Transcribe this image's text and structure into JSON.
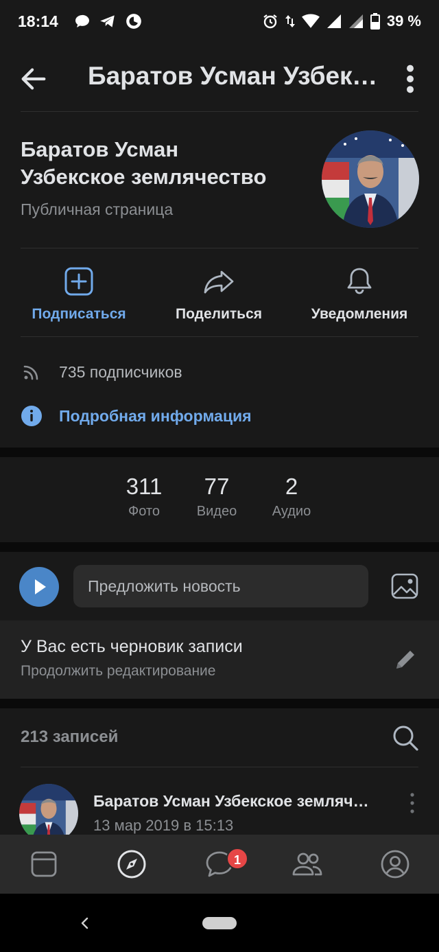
{
  "status_bar": {
    "time": "18:14",
    "battery": "39 %"
  },
  "header": {
    "title": "Баратов Усман Узбекское землячество"
  },
  "profile": {
    "name_line1": "Баратов Усман",
    "name_line2": "Узбекское землячество",
    "type": "Публичная страница"
  },
  "actions": [
    {
      "label": "Подписаться",
      "icon": "plus-square-icon"
    },
    {
      "label": "Поделиться",
      "icon": "share-icon"
    },
    {
      "label": "Уведомления",
      "icon": "bell-icon"
    }
  ],
  "info": {
    "followers": "735 подписчиков",
    "details_link": "Подробная информация"
  },
  "counters": [
    {
      "value": "311",
      "label": "Фото"
    },
    {
      "value": "77",
      "label": "Видео"
    },
    {
      "value": "2",
      "label": "Аудио"
    }
  ],
  "suggest": {
    "placeholder": "Предложить новость"
  },
  "draft": {
    "title": "У Вас есть черновик записи",
    "subtitle": "Продолжить редактирование"
  },
  "posts": {
    "count_label": "213 записей",
    "first_post": {
      "author": "Баратов Усман Узбекское землячество",
      "date": "13 мар 2019 в 15:13"
    }
  },
  "tabbar": {
    "items": [
      "news-tab-icon",
      "explore-tab-icon",
      "messages-tab-icon",
      "friends-tab-icon",
      "profile-tab-icon"
    ],
    "messages_badge": "1"
  },
  "colors": {
    "background": "#191919",
    "accent": "#71aaeb",
    "muted_text": "#8c8f93",
    "badge": "#e64646"
  }
}
